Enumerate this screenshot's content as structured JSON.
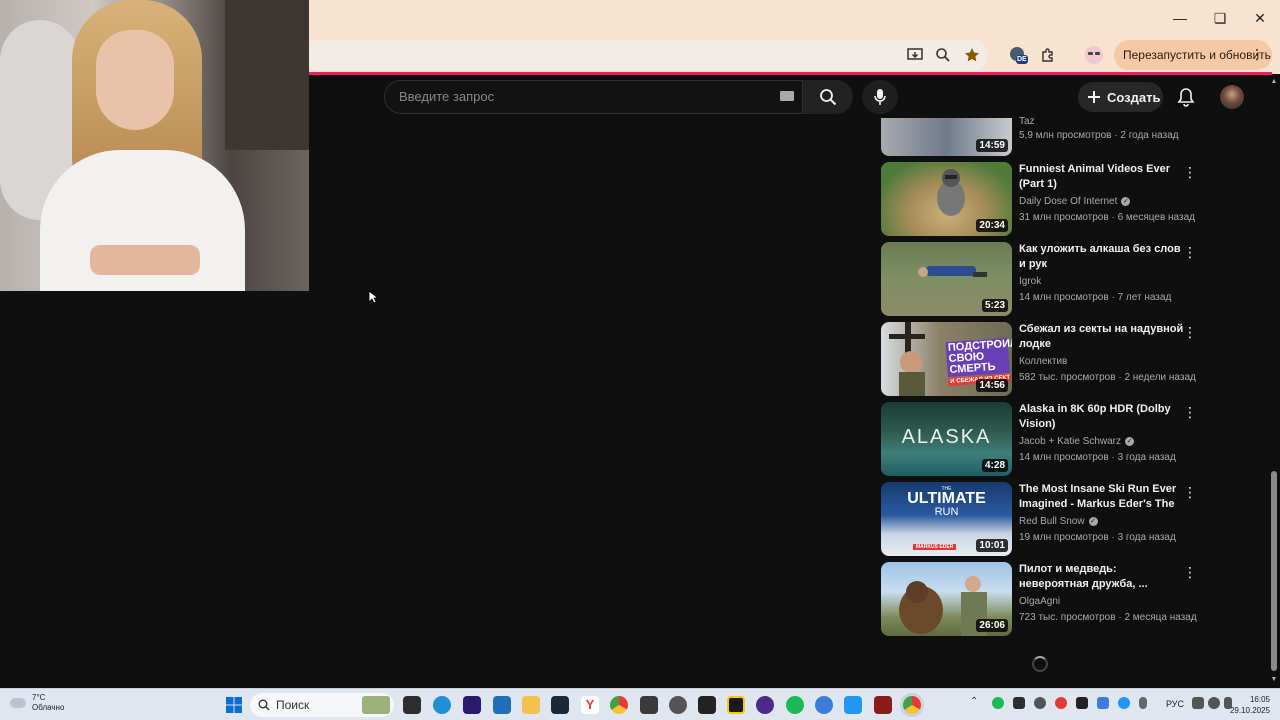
{
  "browser": {
    "relaunch_label": "Перезапустить и обновить",
    "extension_badge": "DE"
  },
  "youtube": {
    "search_placeholder": "Введите запрос",
    "create_label": "Создать",
    "partial_item": {
      "channel": "Taz",
      "views": "5,9 млн просмотров · 2 года назад",
      "duration": "14:59"
    },
    "videos": [
      {
        "title": "Funniest Animal Videos Ever (Part 1)",
        "channel": "Daily Dose Of Internet",
        "verified": true,
        "views": "31 млн просмотров · 6 месяцев назад",
        "duration": "20:34"
      },
      {
        "title": "Как уложить алкаша без слов и рук",
        "channel": "Igrok",
        "verified": false,
        "views": "14 млн просмотров · 7 лет назад",
        "duration": "5:23"
      },
      {
        "title": "Сбежал из секты на надувной лодке",
        "channel": "Коллектив",
        "verified": false,
        "views": "582 тыс. просмотров · 2 недели назад",
        "duration": "14:56",
        "thumb_text": "ПОДСТРОИЛ СВОЮ СМЕРТЬ",
        "thumb_sub": "И СБЕЖАЛ ИЗ СЕКТЫ"
      },
      {
        "title": "Alaska in 8K 60p HDR  (Dolby Vision)",
        "channel": "Jacob + Katie Schwarz",
        "verified": true,
        "views": "14 млн просмотров · 3 года назад",
        "duration": "4:28",
        "thumb_text": "ALASKA"
      },
      {
        "title": "The Most Insane Ski Run Ever Imagined - Markus Eder's The ...",
        "channel": "Red Bull Snow",
        "verified": true,
        "views": "19 млн просмотров · 3 года назад",
        "duration": "10:01",
        "thumb_text": "ULTIMATE",
        "thumb_sub": "RUN",
        "thumb_small": "THE",
        "thumb_tag": "MARKUS EDER"
      },
      {
        "title": "Пилот и медведь: невероятная дружба, ...",
        "channel": "OlgaAgni",
        "verified": false,
        "views": "723 тыс. просмотров · 2 месяца назад",
        "duration": "26:06"
      }
    ]
  },
  "taskbar": {
    "weather_temp": "7°C",
    "weather_desc": "Облачно",
    "search_label": "Поиск",
    "lang": "РУС",
    "time": "16:05",
    "date": "29.10.2025"
  }
}
